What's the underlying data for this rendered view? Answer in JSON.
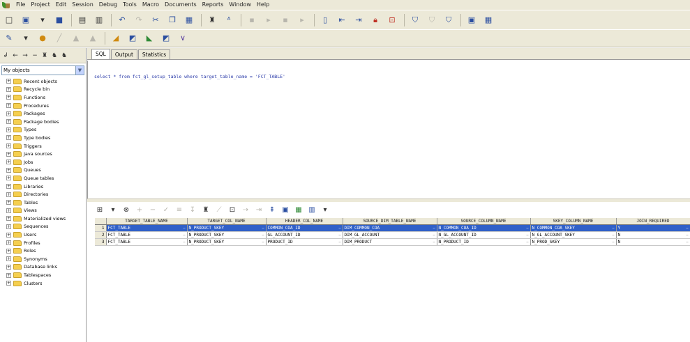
{
  "menu": [
    "File",
    "Project",
    "Edit",
    "Session",
    "Debug",
    "Tools",
    "Macro",
    "Documents",
    "Reports",
    "Window",
    "Help"
  ],
  "left_pane": {
    "selector_value": "My objects",
    "tree_items": [
      "Recent objects",
      "Recycle bin",
      "Functions",
      "Procedures",
      "Packages",
      "Package bodies",
      "Types",
      "Type bodies",
      "Triggers",
      "Java sources",
      "Jobs",
      "Queues",
      "Queue tables",
      "Libraries",
      "Directories",
      "Tables",
      "Views",
      "Materialized views",
      "Sequences",
      "Users",
      "Profiles",
      "Roles",
      "Synonyms",
      "Database links",
      "Tablespaces",
      "Clusters"
    ]
  },
  "editor": {
    "tabs": [
      "SQL",
      "Output",
      "Statistics"
    ],
    "sql": "select * from fct_gl_setup_table where target_table_name = 'FCT_TABLE'"
  },
  "grid": {
    "columns": [
      "",
      "TARGET_TABLE_NAME",
      "TARGET_COL_NAME",
      "HEADER_COL_NAME",
      "SOURCE_DIM_TABLE_NAME",
      "SOURCE_COLUMN_NAME",
      "SKEY_COLUMN_NAME",
      "JOIN_REQUIRED"
    ],
    "rows": [
      [
        "1",
        "FCT_TABLE",
        "N_PRODUCT_SKEY",
        "COMMON_COA_ID",
        "DIM_COMMON_COA",
        "N_COMMON_COA_ID",
        "N_COMMON_COA_SKEY",
        "Y"
      ],
      [
        "2",
        "FCT_TABLE",
        "N_PRODUCT_SKEY",
        "GL_ACCOUNT_ID",
        "DIM_GL_ACCOUNT",
        "N_GL_ACCOUNT_ID",
        "N_GL_ACCOUNT_SKEY",
        "N"
      ],
      [
        "3",
        "FCT_TABLE",
        "N_PRODUCT_SKEY",
        "PRODUCT_ID",
        "DIM_PRODUCT",
        "N_PRODUCT_ID",
        "N_PROD_SKEY",
        "N"
      ]
    ],
    "selected_row": 0
  },
  "colors": {
    "selection": "#3060c8",
    "chrome": "#ece9d8",
    "sql_text": "#2a3aa8"
  }
}
